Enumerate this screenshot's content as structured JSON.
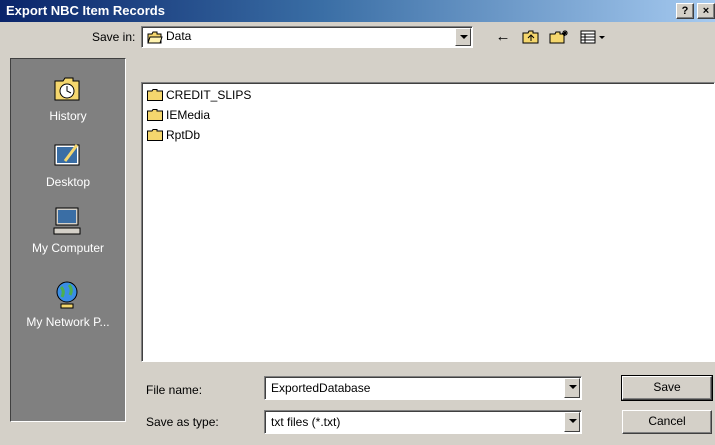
{
  "title": "Export NBC Item Records",
  "titlebar_buttons": {
    "help": "?",
    "close": "×"
  },
  "save_in": {
    "label": "Save in:",
    "value": "Data"
  },
  "toolbar": {
    "back": "←",
    "up": "⤴",
    "new_folder": "✳",
    "views": "▦▾"
  },
  "places": [
    {
      "label": "History",
      "icon": "history-icon"
    },
    {
      "label": "Desktop",
      "icon": "desktop-icon"
    },
    {
      "label": "My Computer",
      "icon": "computer-icon"
    },
    {
      "label": "My Network P...",
      "icon": "network-icon"
    }
  ],
  "files": [
    {
      "name": "CREDIT_SLIPS",
      "icon": "folder-icon"
    },
    {
      "name": "IEMedia",
      "icon": "folder-icon"
    },
    {
      "name": "RptDb",
      "icon": "folder-icon"
    }
  ],
  "file_name": {
    "label": "File name:",
    "value": "ExportedDatabase"
  },
  "save_as_type": {
    "label": "Save as type:",
    "value": "txt files (*.txt)"
  },
  "buttons": {
    "save": "Save",
    "cancel": "Cancel"
  },
  "colors": {
    "title_start": "#0a246a",
    "title_end": "#a6caf0",
    "face": "#d4d0c8",
    "places_bg": "#808080",
    "folder": "#f5d76e"
  }
}
